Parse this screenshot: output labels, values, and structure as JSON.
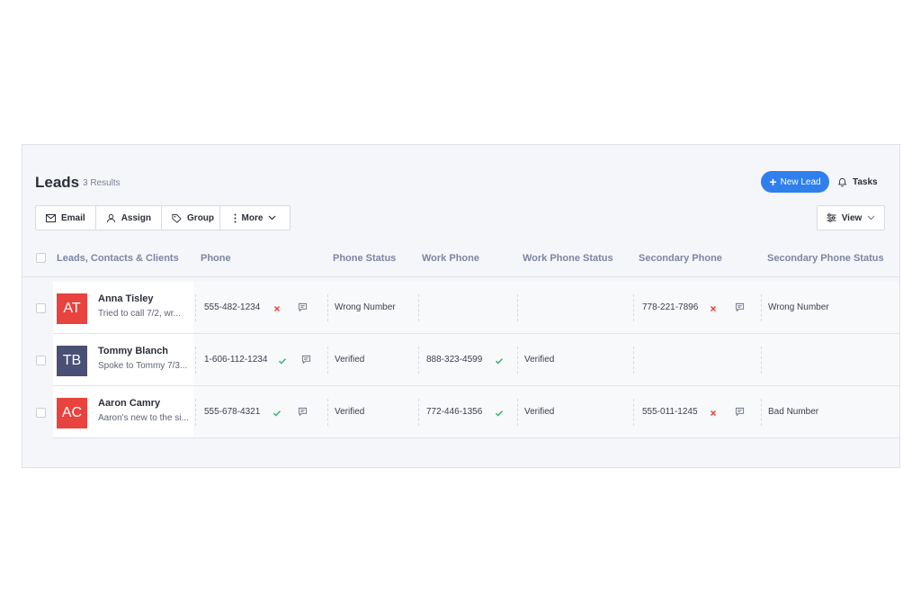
{
  "header": {
    "title": "Leads",
    "count": "3 Results",
    "new_lead_label": "New Lead",
    "tasks_label": "Tasks"
  },
  "toolbar": {
    "email": "Email",
    "assign": "Assign",
    "group": "Group",
    "more": "More",
    "view": "View"
  },
  "columns": [
    "Leads, Contacts & Clients",
    "Phone",
    "Phone Status",
    "Work Phone",
    "Work Phone Status",
    "Secondary Phone",
    "Secondary Phone Status"
  ],
  "rows": [
    {
      "initials": "AT",
      "avatar_color": "#e8433f",
      "name": "Anna Tisley",
      "note": "Tried to call 7/2, wr...",
      "phone": "555-482-1234",
      "phone_state": "invalid",
      "phone_status": "Wrong Number",
      "work_phone": "",
      "work_phone_status": "",
      "secondary_phone": "778-221-7896",
      "secondary_state": "invalid",
      "secondary_status": "Wrong Number"
    },
    {
      "initials": "TB",
      "avatar_color": "#4a5075",
      "name": "Tommy Blanch",
      "note": "Spoke to Tommy 7/3...",
      "phone": "1-606-112-1234",
      "phone_state": "valid",
      "phone_status": "Verified",
      "work_phone": "888-323-4599",
      "work_state": "valid",
      "work_phone_status": "Verified",
      "secondary_phone": "",
      "secondary_status": ""
    },
    {
      "initials": "AC",
      "avatar_color": "#e8433f",
      "name": "Aaron Camry",
      "note": "Aaron's new to the si...",
      "phone": "555-678-4321",
      "phone_state": "valid",
      "phone_status": "Verified",
      "work_phone": "772-446-1356",
      "work_state": "valid",
      "work_phone_status": "Verified",
      "secondary_phone": "555-011-1245",
      "secondary_state": "invalid",
      "secondary_status": "Bad Number"
    }
  ],
  "colors": {
    "accent": "#2f80ed",
    "valid": "#3cb371",
    "invalid": "#e8433f"
  }
}
